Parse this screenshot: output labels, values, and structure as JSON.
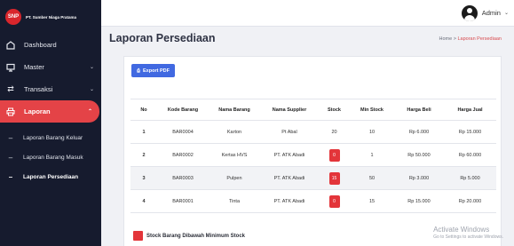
{
  "brand": {
    "logo_text": "SNP",
    "name": "PT. Sumber Niaga Pratama"
  },
  "sidebar": {
    "items": [
      {
        "label": "Dashboard",
        "icon": "dashboard-icon"
      },
      {
        "label": "Master",
        "icon": "monitor-icon"
      },
      {
        "label": "Transaksi",
        "icon": "transfer-icon"
      },
      {
        "label": "Laporan",
        "icon": "print-icon"
      }
    ],
    "subitems": [
      {
        "label": "Laporan Barang Keluar"
      },
      {
        "label": "Laporan Barang Masuk"
      },
      {
        "label": "Laporan Persediaan"
      }
    ]
  },
  "topbar": {
    "user": "Admin"
  },
  "page": {
    "title": "Laporan Persediaan",
    "breadcrumb_home": "Home",
    "breadcrumb_sep": ">",
    "breadcrumb_current": "Laporan Persediaan"
  },
  "export_label": "Export PDF",
  "table": {
    "headers": [
      "No",
      "Kode Barang",
      "Nama Barang",
      "Nama Supplier",
      "Stock",
      "Min Stock",
      "Harga Beli",
      "Harga Jual"
    ],
    "rows": [
      [
        "1",
        "BAR0004",
        "Karton",
        "Pt Abal",
        "20",
        "10",
        "Rp 6.000",
        "Rp 15.000"
      ],
      [
        "2",
        "BAR0002",
        "Kertas HVS",
        "PT. ATK Abadi",
        "0",
        "1",
        "Rp 50.000",
        "Rp 60.000"
      ],
      [
        "3",
        "BAR0003",
        "Pulpen",
        "PT. ATK Abadi",
        "15",
        "50",
        "Rp 3.000",
        "Rp 5.000"
      ],
      [
        "4",
        "BAR0001",
        "Tinta",
        "PT. ATK Abadi",
        "0",
        "15",
        "Rp 15.000",
        "Rp 20.000"
      ]
    ]
  },
  "legend": "Stock Barang Dibawah Minimum Stock",
  "watermark": {
    "title": "Activate Windows",
    "subtitle": "Go to Settings to activate Windows."
  },
  "colors": {
    "accent": "#e44347",
    "sidebar": "#161b2e",
    "button": "#4169e1",
    "badge": "#e3353a"
  }
}
